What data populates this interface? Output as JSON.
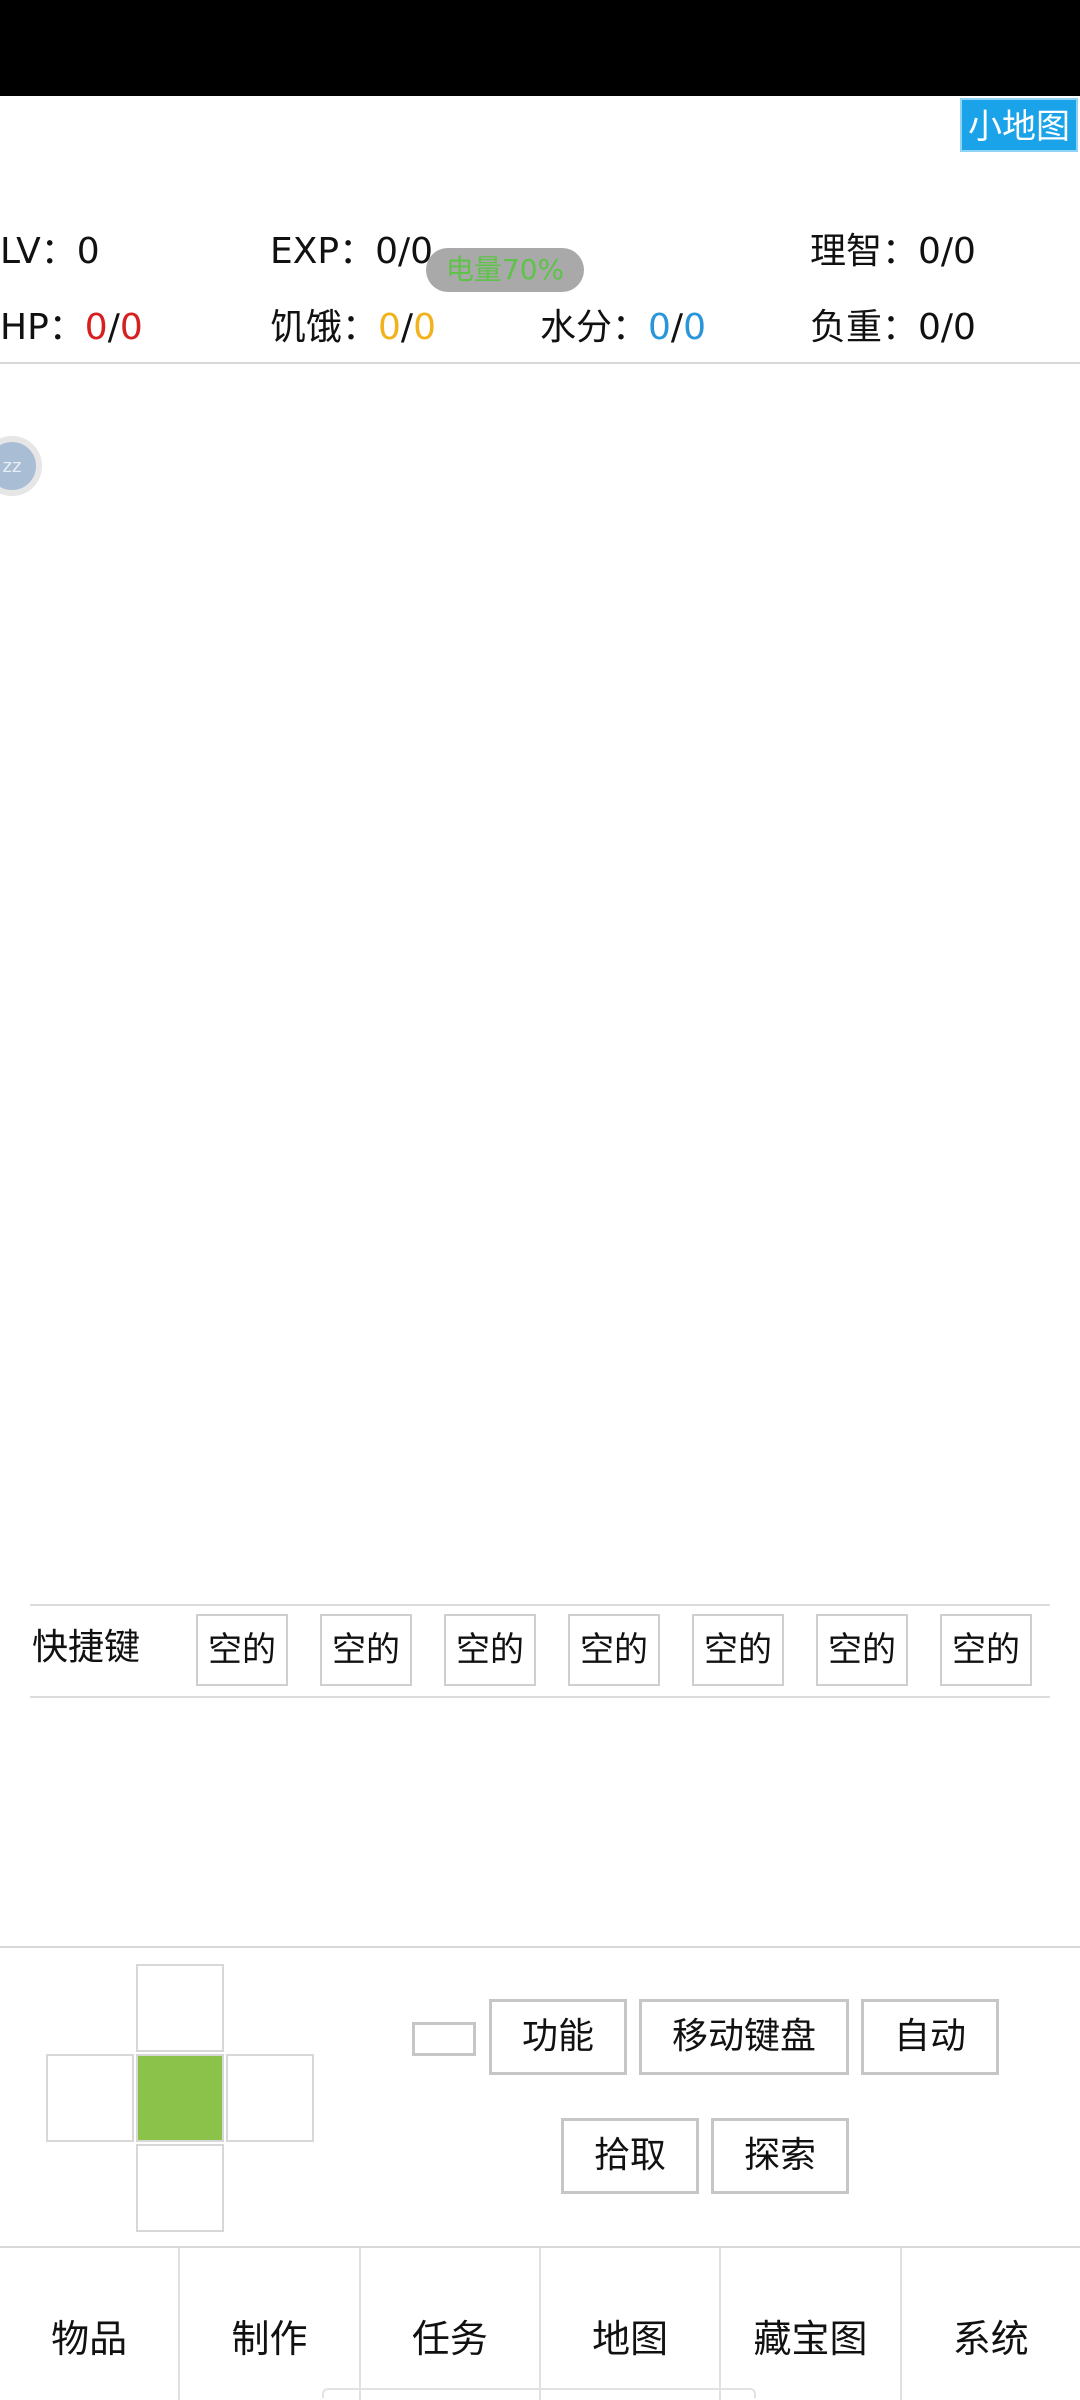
{
  "minimap_label": "小地图",
  "stats": {
    "lv_label": "LV：",
    "lv_value": "0",
    "exp_label": "EXP：",
    "exp_value": "0/0",
    "sanity_label": "理智：",
    "sanity_value": "0/0",
    "hp_label": "HP：",
    "hp_current": "0",
    "hp_max": "0",
    "hunger_label": "饥饿：",
    "hunger_current": "0",
    "hunger_max": "0",
    "water_label": "水分：",
    "water_current": "0",
    "water_max": "0",
    "weight_label": "负重：",
    "weight_value": "0/0",
    "slash": "/"
  },
  "battery_label": "电量70%",
  "sleep_icon_text": "zz",
  "quickkeys": {
    "label": "快捷键",
    "slots": [
      "空的",
      "空的",
      "空的",
      "空的",
      "空的",
      "空的",
      "空的"
    ]
  },
  "controls": {
    "function_label": "功能",
    "move_keyboard_label": "移动键盘",
    "auto_label": "自动",
    "pickup_label": "拾取",
    "explore_label": "探索"
  },
  "tabs": [
    "物品",
    "制作",
    "任务",
    "地图",
    "藏宝图",
    "系统"
  ],
  "colors": {
    "minimap_bg": "#1aa3e8",
    "hp": "#d62020",
    "hunger": "#f2b21b",
    "water": "#2996d9",
    "battery_text": "#5fc24a",
    "dpad_center": "#8bc34a"
  }
}
